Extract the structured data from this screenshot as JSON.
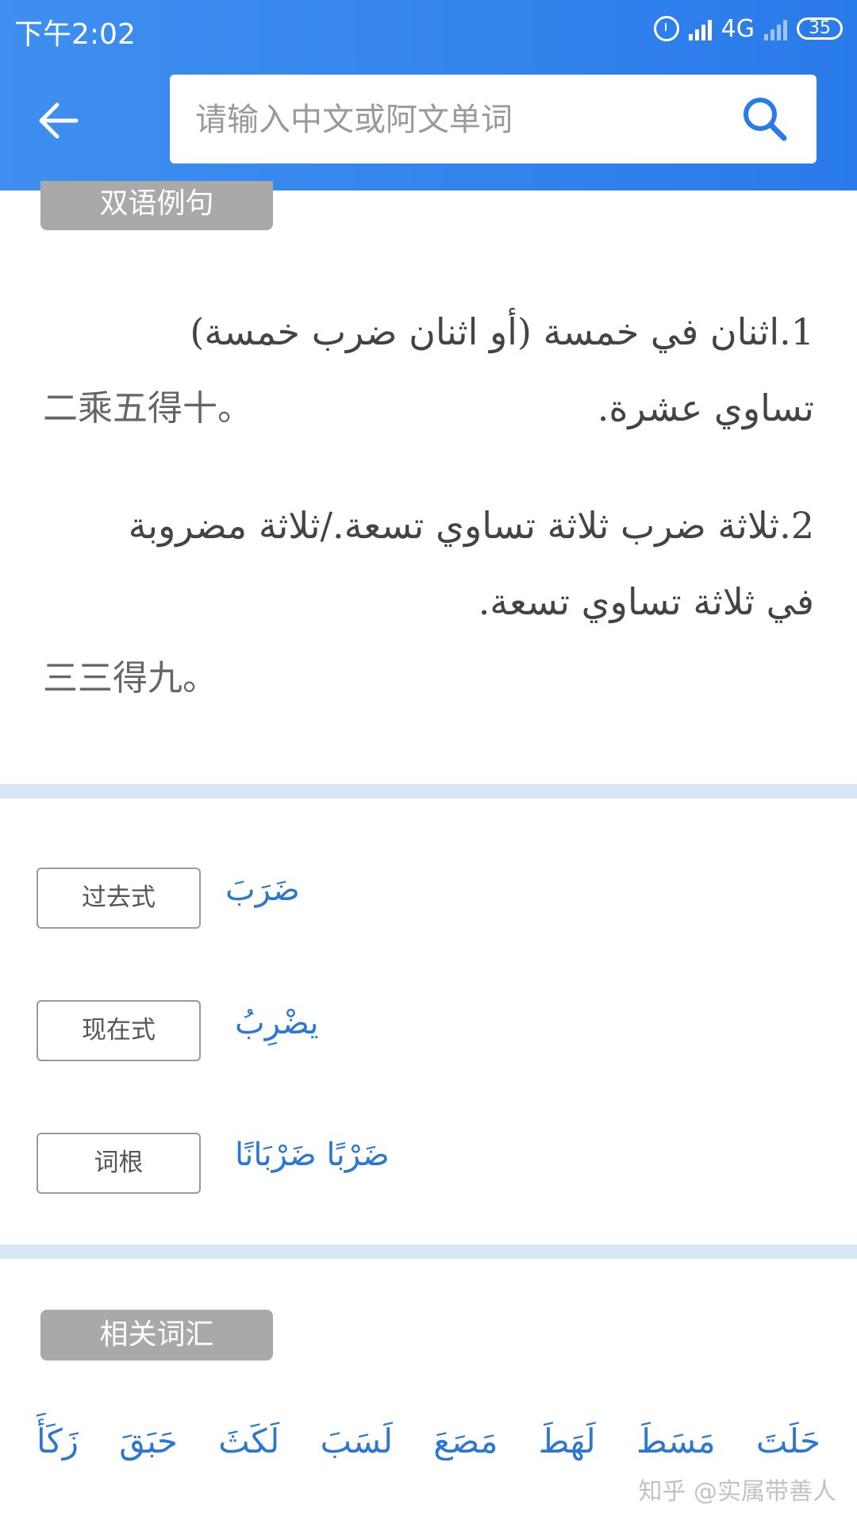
{
  "status_bar": {
    "time": "下午2:02",
    "network": "4G",
    "battery": "35"
  },
  "search": {
    "placeholder": "请输入中文或阿文单词"
  },
  "sections": {
    "examples_badge": "双语例句",
    "related_badge": "相关词汇"
  },
  "examples": [
    {
      "arabic": "1.اثنان في خمسة (أو اثنان ضرب خمسة) تساوي عشرة.",
      "chinese": "二乘五得十。"
    },
    {
      "arabic": "2.ثلاثة ضرب ثلاثة تساوي تسعة./ثلاثة مضروبة في ثلاثة تساوي تسعة.",
      "chinese": "三三得九。"
    }
  ],
  "forms": [
    {
      "label": "过去式",
      "value": "ضَرَبَ"
    },
    {
      "label": "现在式",
      "value": "يضْرِبُ"
    },
    {
      "label": "词根",
      "value": "ضَرْبًا  ضَرْبَانًا"
    }
  ],
  "related_words": [
    "حَلَتَ",
    "مَسَطَ",
    "لَهَطَ",
    "مَصَعَ",
    "لَسَبَ",
    "لَكَثَ",
    "حَبَقَ",
    "زَكَأَ"
  ],
  "watermark": "知乎 @实属带善人",
  "colors": {
    "header": "#2f82ec",
    "link_blue": "#2c78d1",
    "divider": "#d7e5f4",
    "badge": "#a9a9a9"
  }
}
